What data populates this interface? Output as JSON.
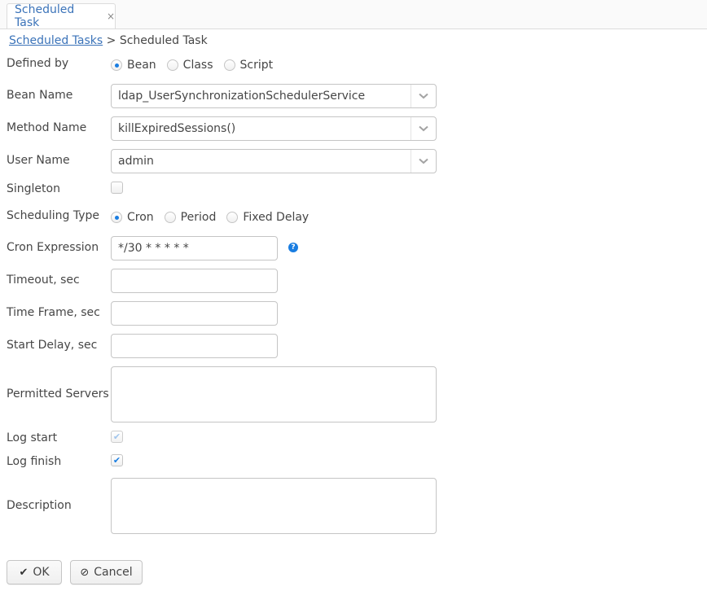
{
  "tab": {
    "label": "Scheduled Task",
    "close": "×"
  },
  "breadcrumb": {
    "parent": "Scheduled Tasks",
    "separator": ">",
    "current": "Scheduled Task"
  },
  "form": {
    "defined_by": {
      "label": "Defined by",
      "options": [
        "Bean",
        "Class",
        "Script"
      ],
      "selected": "Bean"
    },
    "bean_name": {
      "label": "Bean Name",
      "value": "ldap_UserSynchronizationSchedulerService"
    },
    "method_name": {
      "label": "Method Name",
      "value": "killExpiredSessions()"
    },
    "user_name": {
      "label": "User Name",
      "value": "admin"
    },
    "singleton": {
      "label": "Singleton",
      "checked": false
    },
    "scheduling_type": {
      "label": "Scheduling Type",
      "options": [
        "Cron",
        "Period",
        "Fixed Delay"
      ],
      "selected": "Cron"
    },
    "cron_expression": {
      "label": "Cron Expression",
      "value": "*/30 * * * * *"
    },
    "timeout": {
      "label": "Timeout, sec",
      "value": ""
    },
    "time_frame": {
      "label": "Time Frame, sec",
      "value": ""
    },
    "start_delay": {
      "label": "Start Delay, sec",
      "value": ""
    },
    "permitted_servers": {
      "label": "Permitted Servers",
      "value": ""
    },
    "log_start": {
      "label": "Log start",
      "checked": true,
      "disabled": true
    },
    "log_finish": {
      "label": "Log finish",
      "checked": true
    },
    "description": {
      "label": "Description",
      "value": ""
    }
  },
  "icons": {
    "check": "✔",
    "chevron": "⌄",
    "help": "?",
    "cancel": "⊘"
  },
  "buttons": {
    "ok": "OK",
    "cancel": "Cancel"
  },
  "colors": {
    "accent": "#197de1",
    "link": "#3b73b9"
  }
}
